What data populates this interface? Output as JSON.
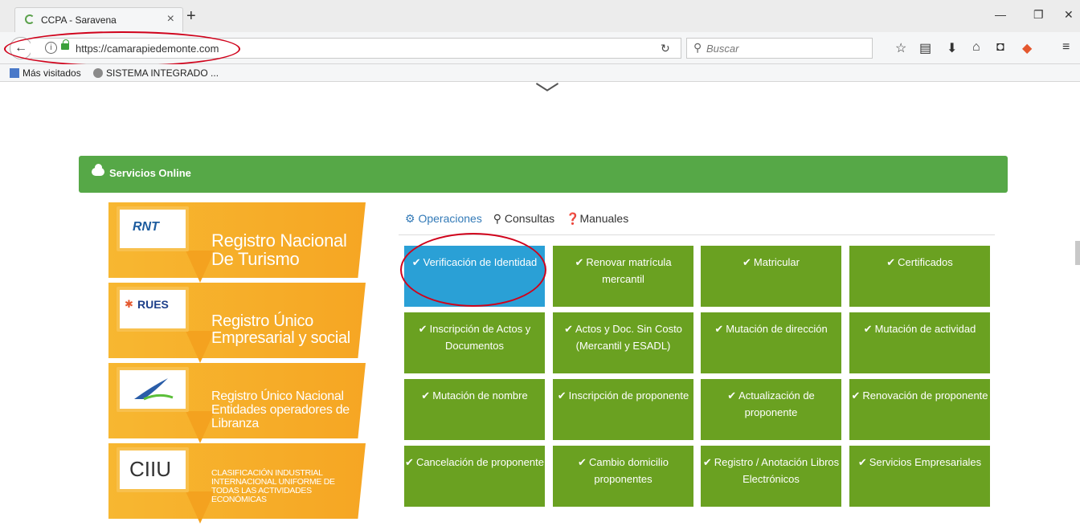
{
  "browser": {
    "tab_title": "CCPA - Saravena",
    "url": "https://camarapiedemonte.com",
    "search_placeholder": "Buscar",
    "bookmarks": [
      "Más visitados",
      "SISTEMA INTEGRADO ..."
    ]
  },
  "panel": {
    "title": "Servicios Online"
  },
  "banners": [
    {
      "logo": "RNT",
      "text": "Registro Nacional De Turismo"
    },
    {
      "logo": "RUES",
      "text": "Registro Único Empresarial y social"
    },
    {
      "logo": "",
      "text": "Registro Único Nacional Entidades operadores de Libranza"
    },
    {
      "logo": "CIIU",
      "text": "CLASIFICACIÓN INDUSTRIAL INTERNACIONAL UNIFORME DE TODAS LAS ACTIVIDADES ECONÓMICAS"
    }
  ],
  "tabs": [
    "Operaciones",
    "Consultas",
    "Manuales"
  ],
  "services": [
    "Verificación de Identidad",
    "Renovar matrícula mercantil",
    "Matricular",
    "Certificados",
    "Inscripción de Actos y Documentos",
    "Actos y Doc. Sin Costo (Mercantil y ESADL)",
    "Mutación de dirección",
    "Mutación de actividad",
    "Mutación de nombre",
    "Inscripción de proponente",
    "Actualización de proponente",
    "Renovación de proponente",
    "Cancelación de proponente",
    "Cambio domicilio proponentes",
    "Registro / Anotación Libros Electrónicos",
    "Servicios Empresariales"
  ],
  "colors": {
    "panel_green": "#56a847",
    "tile_green": "#6aa121",
    "tile_active_blue": "#2aa0d6",
    "banner_orange": "#f6a623",
    "annotation_red": "#d0021b"
  }
}
